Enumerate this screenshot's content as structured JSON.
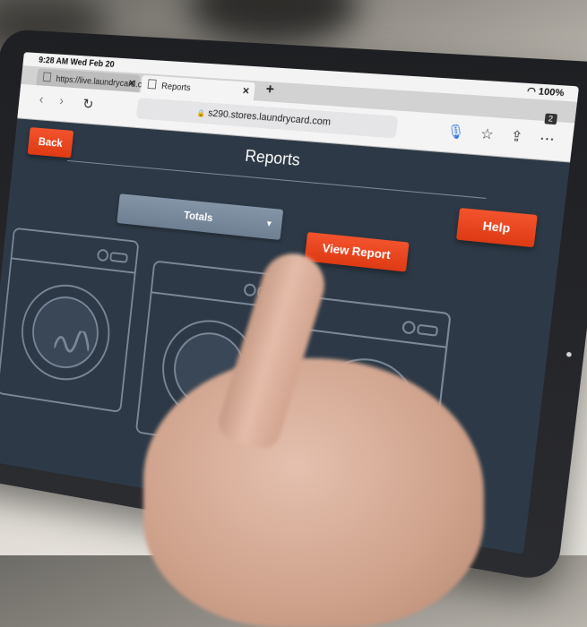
{
  "browser": {
    "status_time": "9:28 AM  Wed Feb 20",
    "battery": "100%",
    "tabs": [
      {
        "label": "https://live.laundrycard.com"
      },
      {
        "label": "Reports"
      }
    ],
    "new_tab": "+",
    "url": "s290.stores.laundrycard.com",
    "tab_count": "2"
  },
  "app": {
    "back_label": "Back",
    "title": "Reports",
    "help_label": "Help",
    "report_select": "Totals",
    "view_report_label": "View Report"
  },
  "colors": {
    "accent": "#ea4a22",
    "screen_bg": "#2d3946",
    "select_bg": "#7a8a9d"
  }
}
